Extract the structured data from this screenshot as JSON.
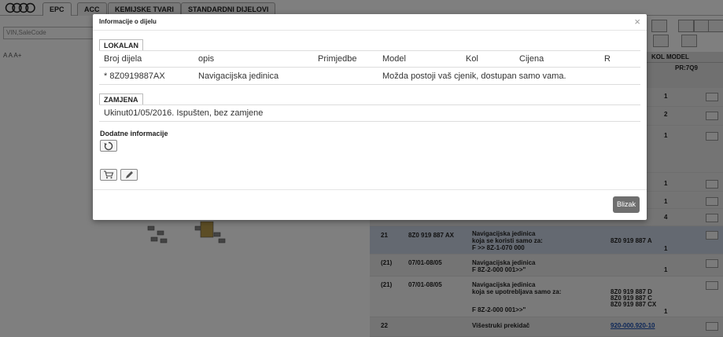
{
  "app": {
    "tabs": [
      "EPC",
      "ACC",
      "KEMIJSKE TVARI",
      "STANDARDNI DIJELOVI"
    ],
    "vin_placeholder": "VIN,SaleCode",
    "font_sizes_label": "A A A+",
    "grid_header": "KOL MODEL",
    "grid_subheader": "PR:7Q9",
    "qty_values": [
      "1",
      "2",
      "1",
      "1",
      "1",
      "4"
    ],
    "rows": [
      {
        "pos": "21",
        "part": "8Z0 919 887 AX",
        "desc1": "Navigacijska jedinica",
        "desc2": "koja se koristi samo za:",
        "desc3": "F >> 8Z-1-070 000",
        "ref": "8Z0 919 887 A",
        "qty": "1"
      },
      {
        "pos": "(21)",
        "part": "07/01-08/05",
        "desc1": "Navigacijska jedinica",
        "desc2": "F 8Z-2-000 001>>\"",
        "qty": "1"
      },
      {
        "pos": "(21)",
        "part": "07/01-08/05",
        "desc1": "Navigacijska jedinica",
        "desc2": "koja se upotrebljava samo za:",
        "desc3": "F 8Z-2-000 001>>\"",
        "ref1": "8Z0 919 887 D",
        "ref2": "8Z0 919 887 C",
        "ref3": "8Z0 919 887 CX",
        "qty": "1"
      },
      {
        "pos": "22",
        "desc1": "Višestruki prekidač",
        "link1": "920-000.920-10"
      }
    ]
  },
  "modal": {
    "title": "Informacije o dijelu",
    "close": "×",
    "lokalan_label": "LOKALAN",
    "columns": [
      "Broj dijela",
      "opis",
      "Primjedbe",
      "Model",
      "Kol",
      "Cijena",
      "R"
    ],
    "row": {
      "part_number": "* 8Z0919887AX",
      "description": "Navigacijska jedinica",
      "price_note": "Možda postoji vaš cjenik, dostupan samo vama."
    },
    "zamjena_label": "ZAMJENA",
    "zamjena_text": "Ukinut01/05/2016. Ispušten, bez zamjene",
    "extra_info_label": "Dodatne informacije",
    "close_button": "Blizak"
  }
}
